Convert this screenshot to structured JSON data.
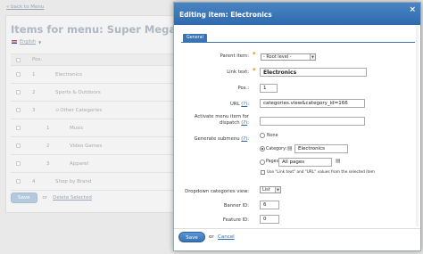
{
  "background": {
    "back_link": "« back to Menu",
    "title": "Items for menu: Super Mega Menu",
    "language": "English",
    "table_header_pos": "Pos.",
    "rows": [
      {
        "pos": "1",
        "name": "Electronics",
        "indent": 0,
        "expander": ""
      },
      {
        "pos": "2",
        "name": "Sports & Outdoors",
        "indent": 0,
        "expander": ""
      },
      {
        "pos": "3",
        "name": "Other Categories",
        "indent": 0,
        "expander": "⊖"
      },
      {
        "pos": "1",
        "name": "Music",
        "indent": 1,
        "expander": ""
      },
      {
        "pos": "2",
        "name": "Video Games",
        "indent": 1,
        "expander": ""
      },
      {
        "pos": "3",
        "name": "Apparel",
        "indent": 1,
        "expander": ""
      },
      {
        "pos": "4",
        "name": "Shop by Brand",
        "indent": 0,
        "expander": ""
      }
    ],
    "save_label": "Save",
    "or_label": "or",
    "delete_label": "Delete Selected"
  },
  "dialog": {
    "title": "Editing item: Electronics",
    "close": "×",
    "tab": "General",
    "parent_item_label": "Parent item:",
    "parent_item_value": "- Root level -",
    "link_text_label": "Link text:",
    "link_text_value": "Electronics",
    "pos_label": "Pos.:",
    "pos_value": "1",
    "url_label": "URL",
    "help_marker": "(?)",
    "url_value": "categories.view&category_id=166",
    "activate_label_line1": "Activate menu item for",
    "activate_label_line2": "dispatch",
    "generate_label": "Generate submenu",
    "none_label": "None",
    "category_label": "Category:",
    "category_value": "Electronics",
    "pages_label": "Pages:",
    "pages_value": "All pages",
    "use_text_label": "Use \"Link text\" and \"URL\" values from the selected item",
    "dropdown_view_label": "Dropdown categories view:",
    "dropdown_view_value": "List",
    "banner_label": "Banner ID:",
    "banner_value": "6",
    "feature_label": "Feature ID:",
    "feature_value": "0",
    "save_label": "Save",
    "or_label": "or",
    "cancel_label": "Cancel"
  }
}
